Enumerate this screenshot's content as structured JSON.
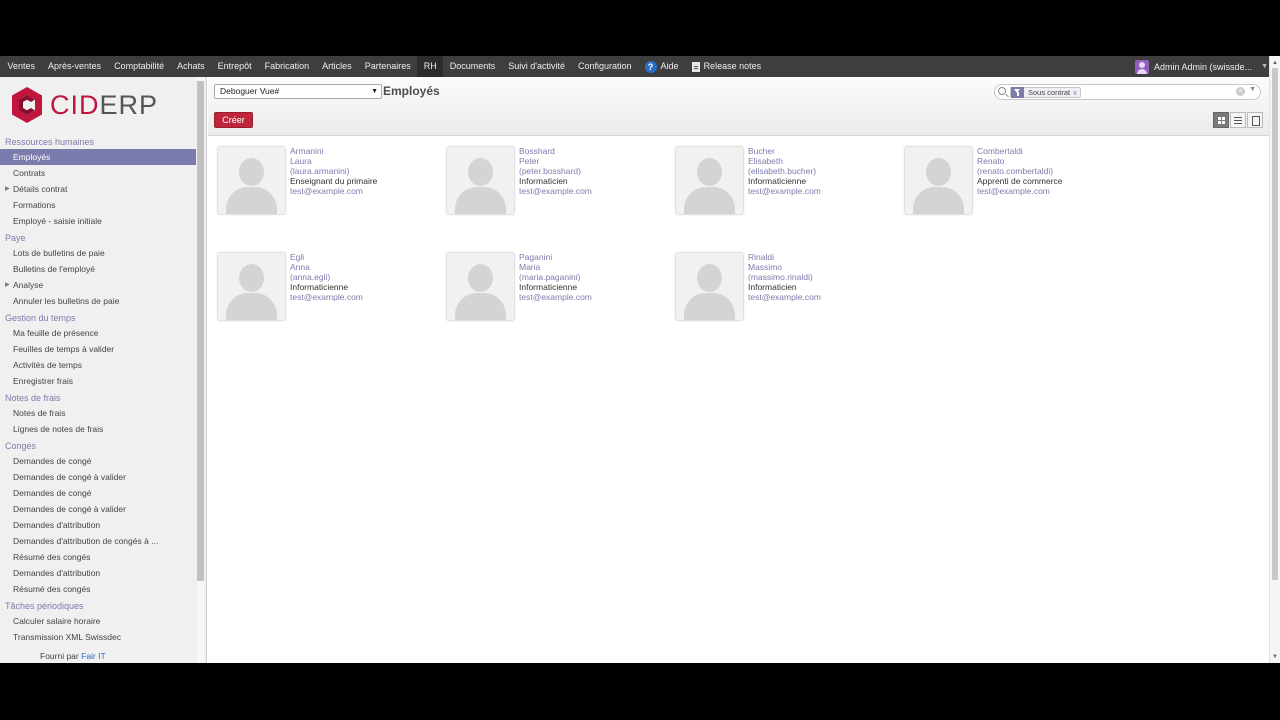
{
  "topbar": {
    "menu": [
      "Ventes",
      "Après-ventes",
      "Comptabilité",
      "Achats",
      "Entrepôt",
      "Fabrication",
      "Articles",
      "Partenaires",
      "RH",
      "Documents",
      "Suivi d'activité",
      "Configuration"
    ],
    "active": "RH",
    "help": "Aide",
    "release_notes": "Release notes",
    "user": "Admin Admin (swissde..."
  },
  "logo": {
    "part1": "CID",
    "part2": "ERP"
  },
  "sidebar": {
    "sections": [
      {
        "title": "Ressources humaines",
        "items": [
          {
            "label": "Employés",
            "active": true
          },
          {
            "label": "Contrats"
          },
          {
            "label": "Détails contrat",
            "expandable": true
          },
          {
            "label": "Formations"
          },
          {
            "label": "Employé - saisie initiale"
          }
        ]
      },
      {
        "title": "Paye",
        "items": [
          {
            "label": "Lots de bulletins de paie"
          },
          {
            "label": "Bulletins de l'employé"
          },
          {
            "label": "Analyse",
            "expandable": true
          },
          {
            "label": "Annuler les bulletins de paie"
          }
        ]
      },
      {
        "title": "Gestion du temps",
        "items": [
          {
            "label": "Ma feuille de présence"
          },
          {
            "label": "Feuilles de temps à valider"
          },
          {
            "label": "Activités de temps"
          },
          {
            "label": "Enregistrer frais"
          }
        ]
      },
      {
        "title": "Notes de frais",
        "items": [
          {
            "label": "Notes de frais"
          },
          {
            "label": "Lignes de notes de frais"
          }
        ]
      },
      {
        "title": "Congés",
        "items": [
          {
            "label": "Demandes de congé"
          },
          {
            "label": "Demandes de congé à valider"
          },
          {
            "label": "Demandes de congé"
          },
          {
            "label": "Demandes de congé à valider"
          },
          {
            "label": "Demandes d'attribution"
          },
          {
            "label": "Demandes d'attribution de congés à ..."
          },
          {
            "label": "Résumé des congés"
          },
          {
            "label": "Demandes d'attribution"
          },
          {
            "label": "Résumé des congés"
          }
        ]
      },
      {
        "title": "Tâches périodiques",
        "items": [
          {
            "label": "Calculer salaire horaire"
          },
          {
            "label": "Transmission XML Swissdec"
          }
        ]
      }
    ],
    "powered_by": "Fourni par",
    "powered_link": "Fair IT"
  },
  "control": {
    "debug_select": "Deboguer Vue#",
    "title": "Employés",
    "search_facet": "Sous contrat",
    "facet_remove": "x",
    "create_label": "Créer"
  },
  "employees": [
    {
      "last": "Armanini",
      "first": "Laura",
      "login": "(laura.armanini)",
      "job": "Enseignant du primaire",
      "email": "test@example.com"
    },
    {
      "last": "Bosshard",
      "first": "Peter",
      "login": "(peter.bosshard)",
      "job": "Informaticien",
      "email": "test@example.com"
    },
    {
      "last": "Bucher",
      "first": "Elisabeth",
      "login": "(elisabeth.bucher)",
      "job": "Informaticienne",
      "email": "test@example.com"
    },
    {
      "last": "Combertaldi",
      "first": "Renato",
      "login": "(renato.combertaldi)",
      "job": "Apprenti de commerce",
      "email": "test@example.com"
    },
    {
      "last": "Egli",
      "first": "Anna",
      "login": "(anna.egli)",
      "job": "Informaticienne",
      "email": "test@example.com"
    },
    {
      "last": "Paganini",
      "first": "Maria",
      "login": "(maria.paganini)",
      "job": "Informaticienne",
      "email": "test@example.com"
    },
    {
      "last": "Rinaldi",
      "first": "Massimo",
      "login": "(massimo.rinaldi)",
      "job": "Informaticien",
      "email": "test@example.com"
    }
  ],
  "colors": {
    "accent": "#7c7bad",
    "brand": "#c0163e",
    "topbar": "#3e3e3e",
    "create_button": "#c0263b"
  }
}
